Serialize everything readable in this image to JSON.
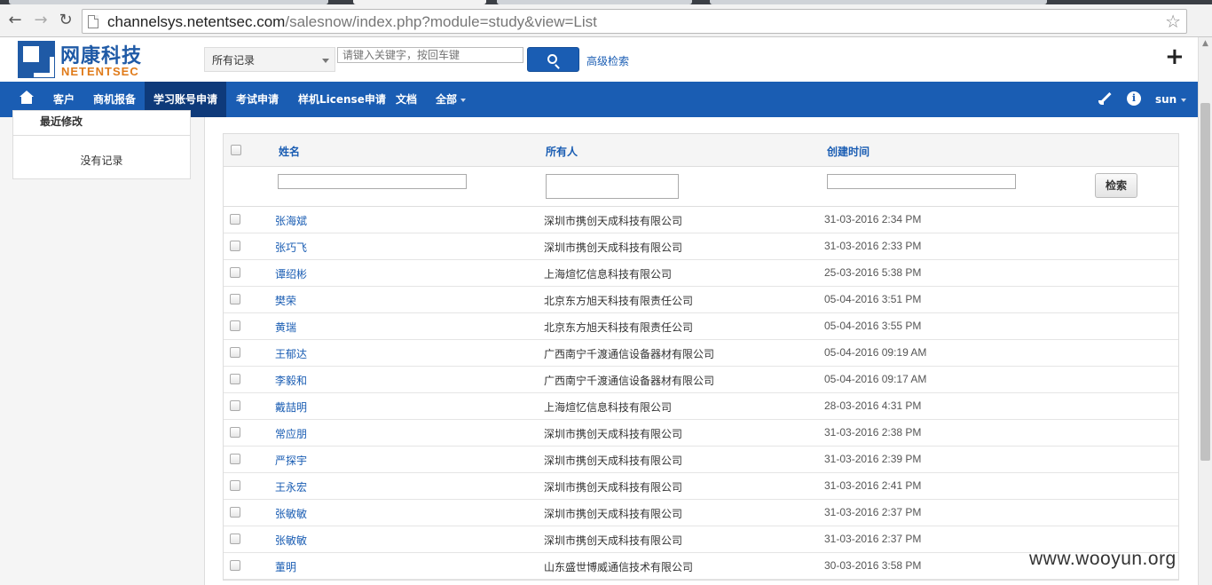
{
  "browser": {
    "url_host": "channelsys.netentsec.com",
    "url_path": "/salesnow/index.php?module=study&view=List"
  },
  "header": {
    "logo_cn": "网康科技",
    "logo_en": "NETENTSEC",
    "filter_select": "所有记录",
    "search_placeholder": "请键入关键字，按回车键",
    "advanced_search": "高级检索"
  },
  "nav": {
    "items": [
      "客户",
      "商机报备",
      "学习账号申请",
      "考试申请",
      "样机License申请",
      "文档",
      "全部"
    ],
    "active_index": 2,
    "user": "sun"
  },
  "sidebar": {
    "recent_title": "最近修改",
    "recent_empty": "没有记录"
  },
  "table": {
    "columns": [
      "姓名",
      "所有人",
      "创建时间"
    ],
    "filter_button": "检索",
    "rows": [
      {
        "name": "张海斌",
        "owner": "深圳市携创天成科技有限公司",
        "time": "31-03-2016 2:34 PM"
      },
      {
        "name": "张巧飞",
        "owner": "深圳市携创天成科技有限公司",
        "time": "31-03-2016 2:33 PM"
      },
      {
        "name": "谭绍彬",
        "owner": "上海煊忆信息科技有限公司",
        "time": "25-03-2016 5:38 PM"
      },
      {
        "name": "樊荣",
        "owner": "北京东方旭天科技有限责任公司",
        "time": "05-04-2016 3:51 PM"
      },
      {
        "name": "黄瑞",
        "owner": "北京东方旭天科技有限责任公司",
        "time": "05-04-2016 3:55 PM"
      },
      {
        "name": "王郁达",
        "owner": "广西南宁千渡通信设备器材有限公司",
        "time": "05-04-2016 09:19 AM"
      },
      {
        "name": "李毅和",
        "owner": "广西南宁千渡通信设备器材有限公司",
        "time": "05-04-2016 09:17 AM"
      },
      {
        "name": "戴喆明",
        "owner": "上海煊忆信息科技有限公司",
        "time": "28-03-2016 4:31 PM"
      },
      {
        "name": "常应朋",
        "owner": "深圳市携创天成科技有限公司",
        "time": "31-03-2016 2:38 PM"
      },
      {
        "name": "严探宇",
        "owner": "深圳市携创天成科技有限公司",
        "time": "31-03-2016 2:39 PM"
      },
      {
        "name": "王永宏",
        "owner": "深圳市携创天成科技有限公司",
        "time": "31-03-2016 2:41 PM"
      },
      {
        "name": "张敏敏",
        "owner": "深圳市携创天成科技有限公司",
        "time": "31-03-2016 2:37 PM"
      },
      {
        "name": "张敏敏",
        "owner": "深圳市携创天成科技有限公司",
        "time": "31-03-2016 2:37 PM"
      },
      {
        "name": "董明",
        "owner": "山东盛世博威通信技术有限公司",
        "time": "30-03-2016 3:58 PM"
      }
    ]
  },
  "watermark": "www.wooyun.org",
  "colors": {
    "brand_blue": "#1a5db3",
    "nav_active": "#0e3a7a",
    "logo_orange": "#e07b1a"
  }
}
